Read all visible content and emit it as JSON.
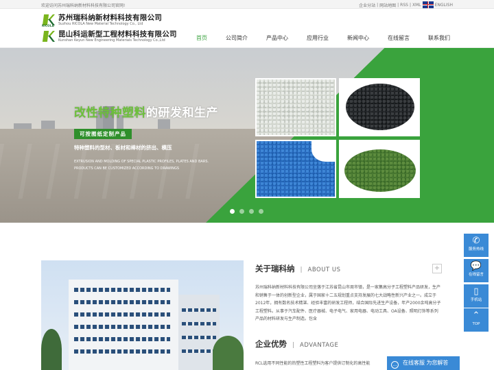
{
  "topbar": {
    "welcome": "欢迎访问苏州瑞科纳新材料科技有限公司官网!",
    "links": [
      "企业分站",
      "|",
      "网站地图",
      "|",
      "RSS",
      "|",
      "XML"
    ],
    "lang": "ENGLISH"
  },
  "logo": {
    "company1_cn": "苏州瑞科纳新材料科技有限公司",
    "company1_en": "Suzhou RICOLA New Material Technology Co., Ltd",
    "company1_mark": "RICOLA",
    "company2_cn": "昆山科运新型工程材料科技有限公司",
    "company2_en": "Kunshan Keyun New Engineering Materials Technology Co.,Ltd"
  },
  "nav": {
    "items": [
      "首页",
      "公司简介",
      "产品中心",
      "应用行业",
      "新闻中心",
      "在线留言",
      "联系我们"
    ],
    "active_index": 0
  },
  "banner": {
    "title_highlight": "改性特种塑料",
    "title_rest": "的研发和生产",
    "badge": "可按图纸定制产品",
    "line1": "特种塑料的型材、板材和棒材的挤出、模压",
    "line2": "EXTRUSION AND MOLDING OF SPECIAL PLASTIC PROFILES, PLATES AND BARS.",
    "line3": "PRODUCTS CAN BE CUSTOMIZED ACCORDING TO DRAWINGS",
    "slide_count": 4,
    "active_slide": 0,
    "colors": {
      "accent_green": "#3aa33d",
      "highlight": "#6cc13a"
    }
  },
  "about": {
    "title_cn": "关于瑞科纳",
    "separator": "|",
    "title_en": "ABOUT US",
    "more": "+",
    "text": "苏州瑞科纳新材料科技有限公司坐落于江苏省昆山市周市镇，是一家集高分子工程塑料产品研发，生产和销售于一体的创新型企业，属于国家十二五规划重点支持发展的七大战略性新兴产业之一。成立于2012年，拥有数名技术精湛、经验丰富的研发工程师，结合国际先进生产设备，年产2000余吨高分子工程塑料。从事于汽车配件、医疗器械、电子电气、家用电器、电动工具、OA设备、照明灯饰等系列产品的材料研发与生产制造。包含"
  },
  "advantage": {
    "title_cn": "企业优势",
    "separator": "|",
    "title_en": "ADVANTAGE",
    "text": "RCL选用不同性能的热塑性工程塑料为客户提供订制化的高性能"
  },
  "float_bar": {
    "items": [
      {
        "icon": "phone-icon",
        "label": "服务热线",
        "glyph": "✆"
      },
      {
        "icon": "message-icon",
        "label": "在线留言",
        "glyph": "💬"
      },
      {
        "icon": "mobile-icon",
        "label": "手机站",
        "glyph": "▯"
      },
      {
        "icon": "arrow-up-icon",
        "label": "TOP",
        "glyph": "⌃"
      }
    ],
    "color": "#3a8ad6"
  },
  "chat": {
    "label": "在线客服 为您解答",
    "icon": "chat-icon"
  }
}
